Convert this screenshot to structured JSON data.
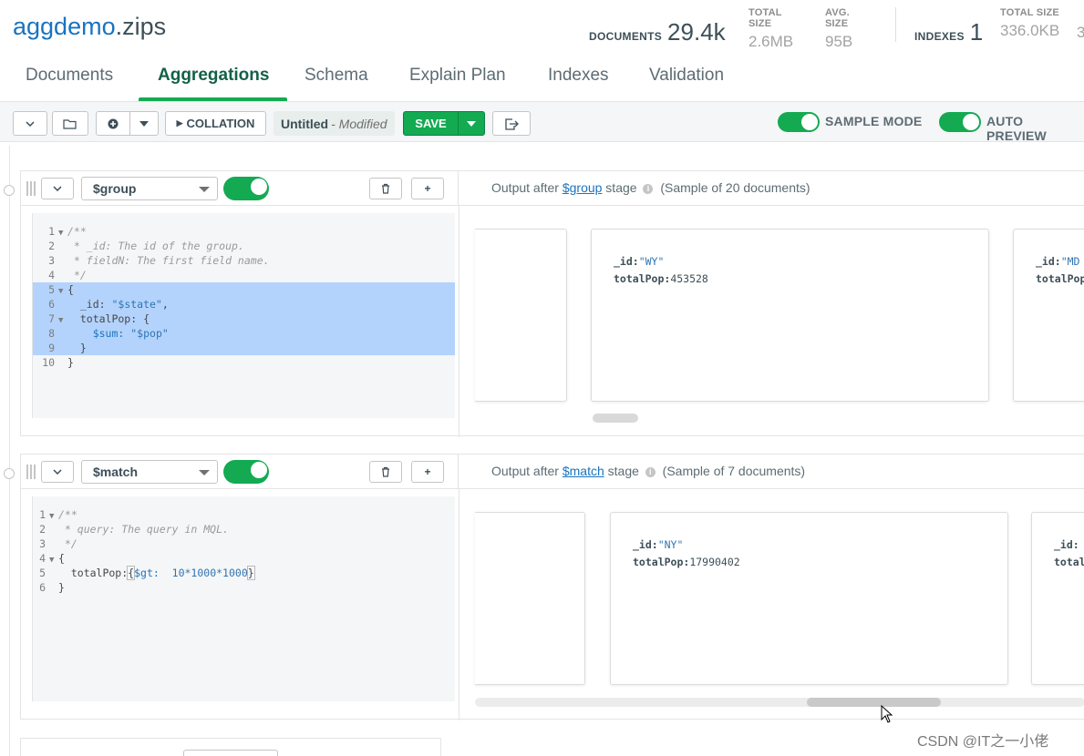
{
  "header": {
    "db": "aggdemo",
    "collection": ".zips",
    "stats": {
      "documents_label": "DOCUMENTS",
      "documents_value": "29.4k",
      "total_size_label": "TOTAL SIZE",
      "total_size_value": "2.6MB",
      "avg_size_label": "AVG. SIZE",
      "avg_size_value": "95B",
      "indexes_label": "INDEXES",
      "indexes_value": "1",
      "index_total_size_label": "TOTAL SIZE",
      "index_total_size_value": "336.0KB",
      "index_avg_cut": "3"
    }
  },
  "tabs": [
    "Documents",
    "Aggregations",
    "Schema",
    "Explain Plan",
    "Indexes",
    "Validation"
  ],
  "active_tab": "Aggregations",
  "toolbar": {
    "collation": "COLLATION",
    "pipeline_name": "Untitled",
    "pipeline_state": "- Modified",
    "save": "SAVE",
    "sample_mode": "SAMPLE MODE",
    "auto_preview": "AUTO PREVIEW"
  },
  "stages": [
    {
      "operator": "$group",
      "enabled": true,
      "output_prefix": "Output after ",
      "output_link": "$group",
      "output_suffix": " stage",
      "sample_text": "(Sample of 20 documents)",
      "docs": [
        {
          "id": "\"WY\"",
          "totalPop": "453528"
        },
        {
          "id": "\"MD",
          "totalPop": ""
        }
      ]
    },
    {
      "operator": "$match",
      "enabled": true,
      "output_prefix": "Output after ",
      "output_link": "$match",
      "output_suffix": " stage",
      "sample_text": "(Sample of 7 documents)",
      "docs": [
        {
          "id": "\"NY\"",
          "totalPop": "17990402"
        }
      ]
    }
  ],
  "code_group": {
    "c1": "/**",
    "c2": " * _id: The id of the group.",
    "c3": " * fieldN: The first field name.",
    "c4": " */",
    "l5": "{",
    "l6a": "  _id: ",
    "l6b": "\"$state\"",
    "l6c": ",",
    "l7": "  totalPop: {",
    "l8a": "    $sum: ",
    "l8b": "\"$pop\"",
    "l9": "  }",
    "l10": "}"
  },
  "code_match": {
    "c1": "/**",
    "c2": " * query: The query in MQL.",
    "c3": " */",
    "l4": "{",
    "l5a": "  totalPop:",
    "l5b": "{",
    "l5c": "$gt:",
    "l5d": "  10*1000*1000",
    "l5e": "}",
    "l6": "}"
  },
  "doc_keys": {
    "id": "_id:",
    "totalPop": "totalPop:"
  },
  "watermark": "CSDN @IT之一小佬"
}
